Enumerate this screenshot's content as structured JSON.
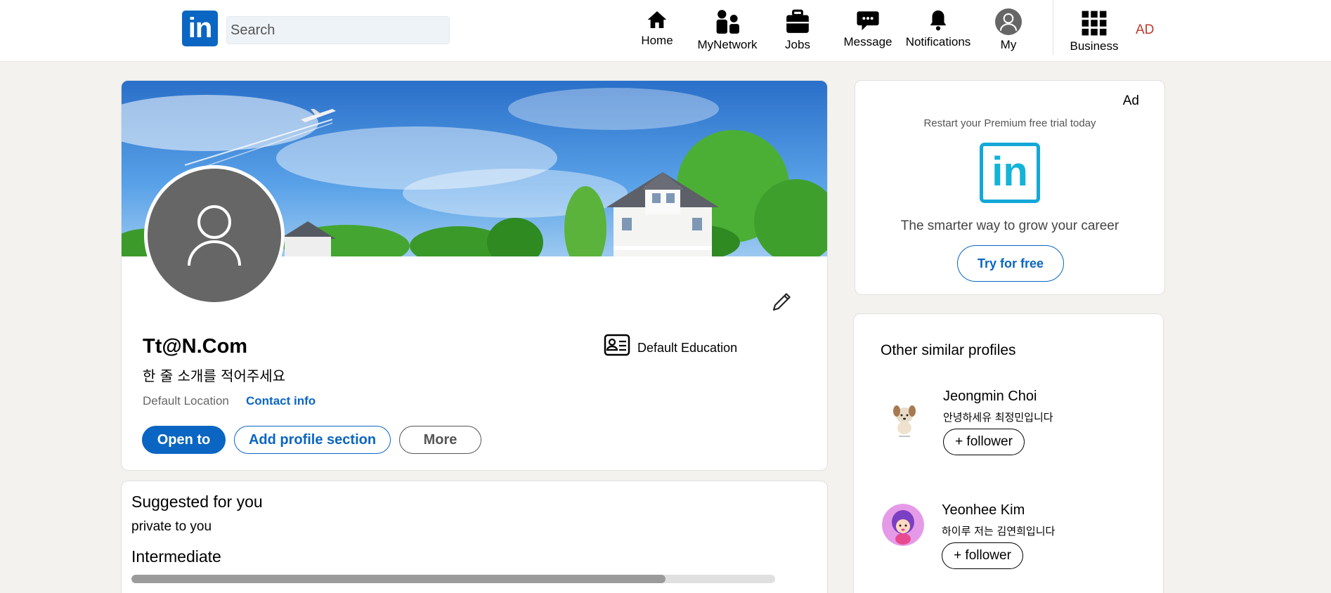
{
  "header": {
    "logo_text": "in",
    "search_placeholder": "Search",
    "nav": [
      {
        "label": "Home",
        "icon": "home-icon"
      },
      {
        "label": "MyNetwork",
        "icon": "people-icon"
      },
      {
        "label": "Jobs",
        "icon": "briefcase-icon"
      },
      {
        "label": "Message",
        "icon": "chat-icon"
      },
      {
        "label": "Notifications",
        "icon": "bell-icon"
      },
      {
        "label": "My",
        "icon": "avatar-icon"
      },
      {
        "label": "Business",
        "icon": "grid-icon"
      }
    ],
    "ad_link": "AD"
  },
  "profile": {
    "name": "Tt@N.Com",
    "headline": "한 줄 소개를 적어주세요",
    "location": "Default Location",
    "contact_label": "Contact info",
    "education": "Default Education",
    "buttons": {
      "open_to": "Open to",
      "add_section": "Add profile section",
      "more": "More"
    }
  },
  "suggested": {
    "title": "Suggested for you",
    "subtitle": "private to you",
    "level": "Intermediate",
    "progress": 0.83
  },
  "ad": {
    "label": "Ad",
    "promo": "Restart your Premium free trial today",
    "logo_text": "in",
    "tagline": "The smarter way to grow your career",
    "cta": "Try for free"
  },
  "similar": {
    "title": "Other similar profiles",
    "people": [
      {
        "name": "Jeongmin Choi",
        "bio": "안녕하세유 최정민입니다",
        "button": "+ follower"
      },
      {
        "name": "Yeonhee Kim",
        "bio": "하이루 저는 김연희입니다",
        "button": "+ follower"
      }
    ]
  },
  "colors": {
    "brand": "#0a66c2",
    "background": "#f3f2ef",
    "ad_link": "#c0392b",
    "avatar_gray": "#666666"
  }
}
